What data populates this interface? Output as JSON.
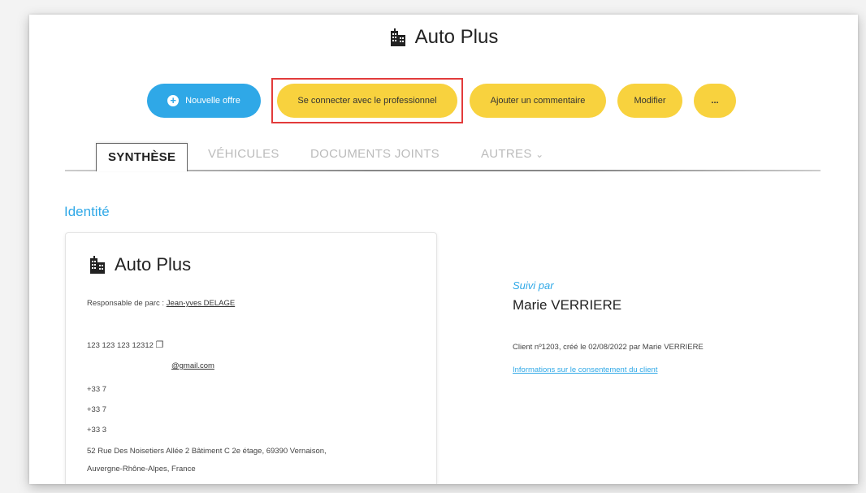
{
  "header": {
    "title": "Auto Plus",
    "icon": "building-icon"
  },
  "actions": {
    "new_offer": "Nouvelle offre",
    "connect": "Se connecter avec le professionnel",
    "add_comment": "Ajouter un commentaire",
    "edit": "Modifier",
    "more": "..."
  },
  "tabs": {
    "synthese": "SYNTHÈSE",
    "vehicules": "VÉHICULES",
    "documents": "DOCUMENTS JOINTS",
    "autres": "AUTRES"
  },
  "identity": {
    "section_title": "Identité",
    "name": "Auto Plus",
    "manager_label": "Responsable de parc :",
    "manager_name": "Jean-yves DELAGE",
    "siret": "123 123 123 12312",
    "email": "@gmail.com",
    "phone1": "+33 7",
    "phone2": "+33 7",
    "phone3": "+33 3",
    "address_line1": "52 Rue Des Noisetiers Allée 2 Bâtiment C 2e étage, 69390 Vernaison,",
    "address_line2": "Auvergne-Rhône-Alpes, France"
  },
  "followed": {
    "label": "Suivi par",
    "name": "Marie VERRIERE",
    "client_info": "Client nº1203, créé le 02/08/2022 par Marie VERRIERE",
    "consent_link": "Informations sur le consentement du client"
  },
  "colors": {
    "accent_blue": "#2fa8e7",
    "button_yellow": "#f8d23e",
    "highlight_red": "#e23b3b"
  }
}
